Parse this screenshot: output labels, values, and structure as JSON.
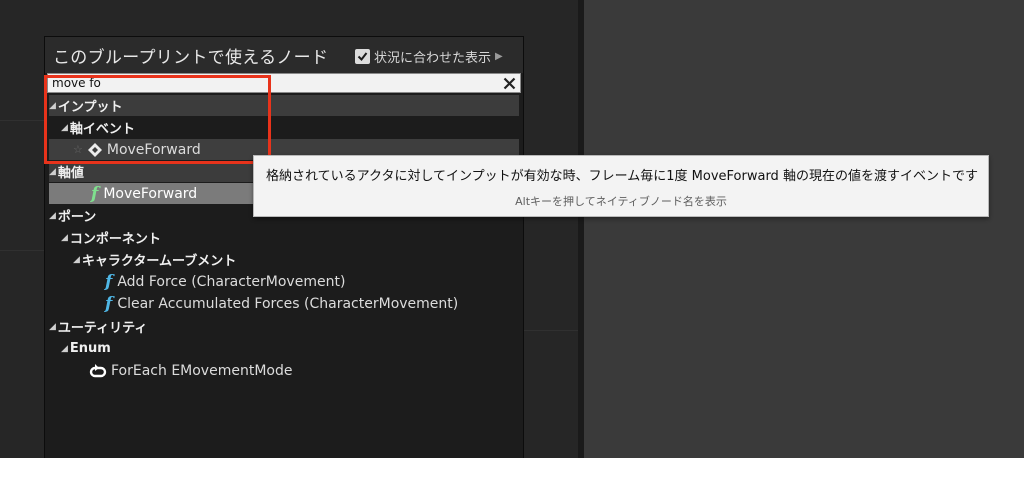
{
  "palette": {
    "title": "このブループリントで使えるノード",
    "context_sensitive_label": "状況に合わせた表示",
    "context_sensitive_checked": true,
    "search_value": "move fo"
  },
  "tree": {
    "input_category": "インプット",
    "axis_events_category": "軸イベント",
    "axis_event_item": "MoveForward",
    "axis_values_category": "軸値",
    "axis_value_item": "MoveForward",
    "pawn_category": "ポーン",
    "components_category": "コンポーネント",
    "char_movement_category": "キャラクタームーブメント",
    "add_force_item": "Add Force (CharacterMovement)",
    "clear_forces_item": "Clear Accumulated Forces (CharacterMovement)",
    "utilities_category": "ユーティリティ",
    "enum_category": "Enum",
    "foreach_item": "ForEach EMovementMode"
  },
  "tooltip": {
    "description": "格納されているアクタに対してインプットが有効な時、フレーム毎に1度 MoveForward 軸の現在の値を渡すイベントです",
    "hint": "Altキーを押してネイティブノード名を表示"
  },
  "colors": {
    "annotation_box": "#e8331b",
    "function_icon": "#4fb7e6",
    "function_icon_selected": "#7fe08e"
  }
}
